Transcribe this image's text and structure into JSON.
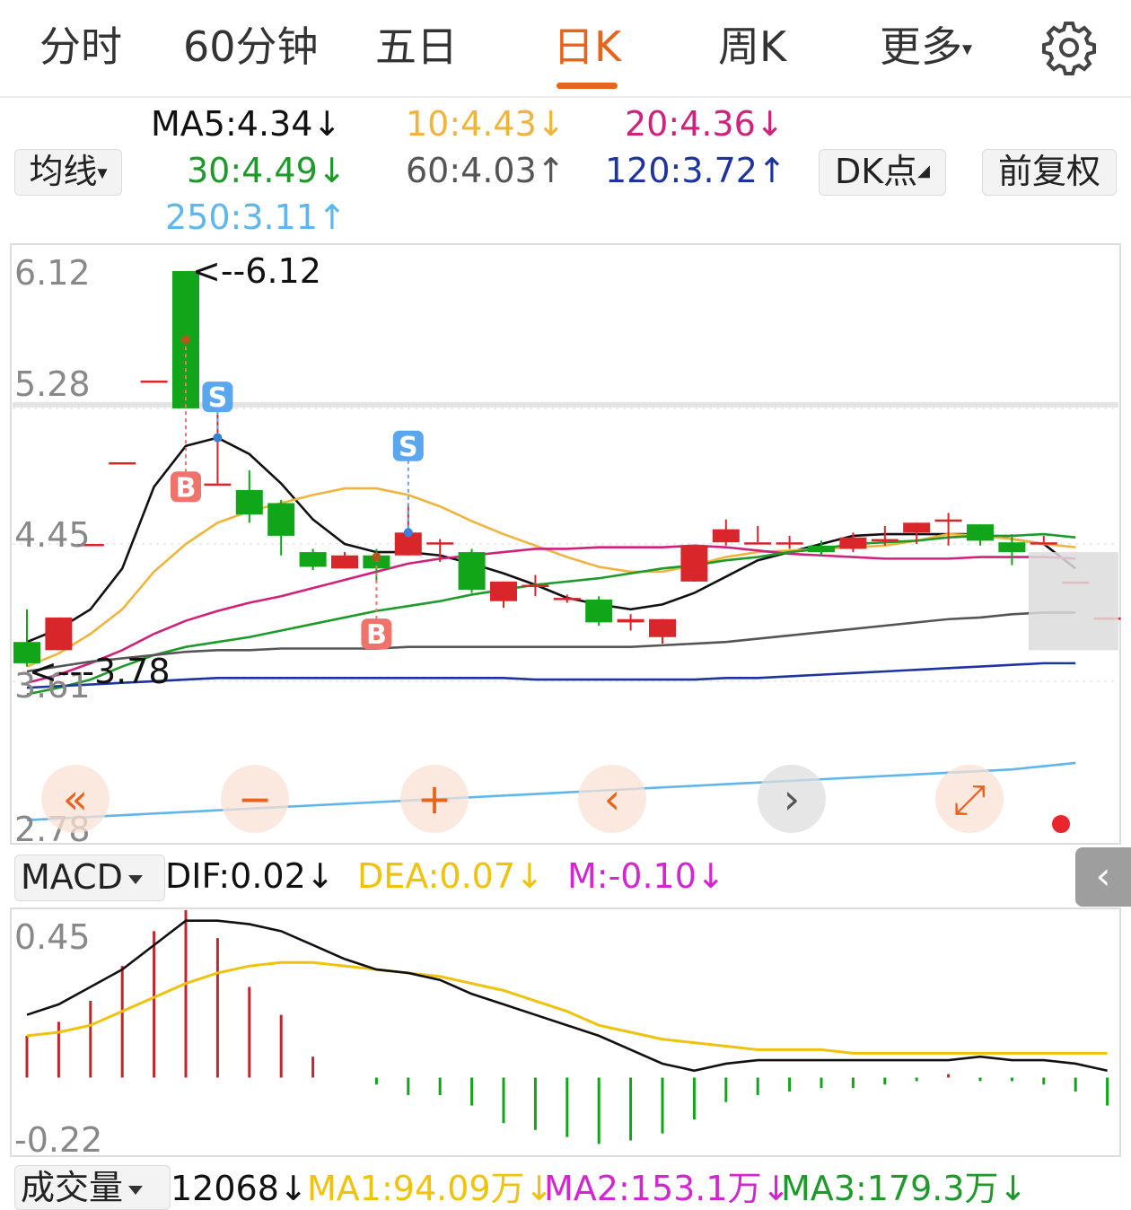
{
  "tabs": [
    "分时",
    "60分钟",
    "五日",
    "日K",
    "周K",
    "更多"
  ],
  "active_tab": "日K",
  "settings_icon": "gear-icon",
  "ma_selector": "均线",
  "ma_values": {
    "ma5": "MA5:4.34",
    "ma10": "10:4.43",
    "ma20": "20:4.36",
    "ma30": "30:4.49",
    "ma60": "60:4.03",
    "ma120": "120:3.72",
    "ma250": "250:3.11"
  },
  "ma_trend": {
    "ma5": "↓",
    "ma10": "↓",
    "ma20": "↓",
    "ma30": "↓",
    "ma60": "↑",
    "ma120": "↑",
    "ma250": "↑"
  },
  "colors": {
    "up": "#d9262b",
    "down": "#11a51a",
    "ma5": "#111111",
    "ma10": "#f0b43c",
    "ma20": "#d0217c",
    "ma30": "#1d9a2a",
    "ma60": "#555555",
    "ma120": "#1d34a0",
    "ma250": "#5eb6ec",
    "accent": "#e8641c",
    "dea": "#f0c20c",
    "m": "#d227d0"
  },
  "dk_button": "DK点",
  "adjust_button": "前复权",
  "price_axis": [
    "6.12",
    "5.28",
    "4.45",
    "3.61",
    "2.78"
  ],
  "high_marker": "<--6.12",
  "low_marker": "<---3.78",
  "signal_markers": [
    "S",
    "B",
    "S",
    "B"
  ],
  "chart_controls": [
    "«",
    "−",
    "+",
    "‹",
    "›",
    "⤢"
  ],
  "macd": {
    "selector": "MACD",
    "dif": "DIF:0.02",
    "dif_trend": "↓",
    "dea": "DEA:0.07",
    "dea_trend": "↓",
    "m": "M:-0.10",
    "m_trend": "↓",
    "axis": [
      "0.45",
      "-0.22"
    ]
  },
  "volume": {
    "selector": "成交量",
    "value": "12068",
    "value_trend": "↓",
    "ma1": "MA1:94.09万",
    "ma1_trend": "↓",
    "ma2": "MA2:153.1万",
    "ma2_trend": "↓",
    "ma3": "MA3:179.3万",
    "ma3_trend": "↓"
  },
  "chart_data": {
    "type": "candlestick",
    "candles": [
      {
        "o": 3.85,
        "c": 3.72,
        "h": 4.05,
        "l": 3.7
      },
      {
        "o": 3.8,
        "c": 4.0,
        "h": 4.0,
        "l": 3.8
      },
      {
        "o": 4.45,
        "c": 4.45,
        "h": 4.45,
        "l": 4.45
      },
      {
        "o": 4.95,
        "c": 4.95,
        "h": 4.95,
        "l": 4.95
      },
      {
        "o": 5.45,
        "c": 5.45,
        "h": 5.45,
        "l": 5.45
      },
      {
        "o": 6.12,
        "c": 5.28,
        "h": 6.12,
        "l": 5.28
      },
      {
        "o": 4.82,
        "c": 4.82,
        "h": 5.25,
        "l": 4.82
      },
      {
        "o": 4.78,
        "c": 4.63,
        "h": 4.9,
        "l": 4.58
      },
      {
        "o": 4.7,
        "c": 4.5,
        "h": 4.72,
        "l": 4.38
      },
      {
        "o": 4.4,
        "c": 4.31,
        "h": 4.42,
        "l": 4.29
      },
      {
        "o": 4.3,
        "c": 4.38,
        "h": 4.4,
        "l": 4.3
      },
      {
        "o": 4.38,
        "c": 4.3,
        "h": 4.42,
        "l": 4.22
      },
      {
        "o": 4.38,
        "c": 4.52,
        "h": 4.7,
        "l": 4.38
      },
      {
        "o": 4.46,
        "c": 4.46,
        "h": 4.48,
        "l": 4.34
      },
      {
        "o": 4.4,
        "c": 4.17,
        "h": 4.42,
        "l": 4.15
      },
      {
        "o": 4.1,
        "c": 4.22,
        "h": 4.22,
        "l": 4.06
      },
      {
        "o": 4.2,
        "c": 4.2,
        "h": 4.26,
        "l": 4.13
      },
      {
        "o": 4.12,
        "c": 4.12,
        "h": 4.14,
        "l": 4.09
      },
      {
        "o": 4.11,
        "c": 3.97,
        "h": 4.13,
        "l": 3.95
      },
      {
        "o": 3.97,
        "c": 3.99,
        "h": 4.02,
        "l": 3.92
      },
      {
        "o": 3.88,
        "c": 3.99,
        "h": 3.99,
        "l": 3.84
      },
      {
        "o": 4.22,
        "c": 4.44,
        "h": 4.44,
        "l": 4.22
      },
      {
        "o": 4.46,
        "c": 4.54,
        "h": 4.6,
        "l": 4.44
      },
      {
        "o": 4.46,
        "c": 4.46,
        "h": 4.56,
        "l": 4.46
      },
      {
        "o": 4.46,
        "c": 4.46,
        "h": 4.5,
        "l": 4.42
      },
      {
        "o": 4.44,
        "c": 4.4,
        "h": 4.47,
        "l": 4.38
      },
      {
        "o": 4.42,
        "c": 4.49,
        "h": 4.52,
        "l": 4.4
      },
      {
        "o": 4.48,
        "c": 4.48,
        "h": 4.56,
        "l": 4.44
      },
      {
        "o": 4.52,
        "c": 4.58,
        "h": 4.58,
        "l": 4.45
      },
      {
        "o": 4.6,
        "c": 4.6,
        "h": 4.64,
        "l": 4.44
      },
      {
        "o": 4.57,
        "c": 4.47,
        "h": 4.57,
        "l": 4.44
      },
      {
        "o": 4.46,
        "c": 4.4,
        "h": 4.51,
        "l": 4.32
      },
      {
        "o": 4.46,
        "c": 4.46,
        "h": 4.5,
        "l": 4.46
      },
      {
        "o": 4.22,
        "c": 4.22,
        "h": 4.22,
        "l": 4.22
      },
      {
        "o": 4.0,
        "c": 4.0,
        "h": 4.0,
        "l": 4.0
      }
    ],
    "ma_series": {
      "ma5": [
        3.85,
        3.93,
        4.05,
        4.3,
        4.8,
        5.05,
        5.1,
        5.0,
        4.82,
        4.6,
        4.45,
        4.4,
        4.4,
        4.38,
        4.33,
        4.27,
        4.2,
        4.12,
        4.08,
        4.05,
        4.08,
        4.15,
        4.25,
        4.35,
        4.4,
        4.45,
        4.5,
        4.51,
        4.51,
        4.51,
        4.51,
        4.48,
        4.45,
        4.3
      ],
      "ma10": [
        3.7,
        3.78,
        3.9,
        4.05,
        4.28,
        4.45,
        4.58,
        4.65,
        4.7,
        4.75,
        4.79,
        4.79,
        4.75,
        4.68,
        4.59,
        4.51,
        4.44,
        4.37,
        4.31,
        4.28,
        4.28,
        4.32,
        4.37,
        4.4,
        4.41,
        4.42,
        4.43,
        4.44,
        4.47,
        4.51,
        4.5,
        4.48,
        4.45,
        4.43
      ],
      "ma20": [
        3.6,
        3.65,
        3.72,
        3.8,
        3.9,
        3.98,
        4.04,
        4.09,
        4.13,
        4.18,
        4.23,
        4.28,
        4.33,
        4.36,
        4.38,
        4.4,
        4.42,
        4.42,
        4.43,
        4.43,
        4.43,
        4.44,
        4.43,
        4.41,
        4.39,
        4.38,
        4.37,
        4.36,
        4.36,
        4.36,
        4.37,
        4.37,
        4.37,
        4.36
      ],
      "ma30": [
        3.53,
        3.57,
        3.62,
        3.7,
        3.77,
        3.82,
        3.85,
        3.88,
        3.92,
        3.96,
        4.0,
        4.04,
        4.07,
        4.1,
        4.14,
        4.17,
        4.2,
        4.22,
        4.24,
        4.27,
        4.3,
        4.32,
        4.35,
        4.37,
        4.4,
        4.42,
        4.45,
        4.46,
        4.47,
        4.49,
        4.5,
        4.5,
        4.51,
        4.49
      ],
      "ma60": [
        3.67,
        3.7,
        3.73,
        3.75,
        3.77,
        3.79,
        3.8,
        3.8,
        3.81,
        3.81,
        3.81,
        3.81,
        3.82,
        3.82,
        3.82,
        3.82,
        3.82,
        3.82,
        3.82,
        3.82,
        3.83,
        3.84,
        3.85,
        3.87,
        3.89,
        3.91,
        3.93,
        3.95,
        3.97,
        3.99,
        4.0,
        4.02,
        4.03,
        4.03
      ],
      "ma120": [
        3.57,
        3.58,
        3.59,
        3.6,
        3.61,
        3.62,
        3.63,
        3.63,
        3.63,
        3.63,
        3.63,
        3.63,
        3.63,
        3.63,
        3.63,
        3.63,
        3.62,
        3.62,
        3.62,
        3.62,
        3.62,
        3.62,
        3.63,
        3.63,
        3.64,
        3.65,
        3.66,
        3.67,
        3.68,
        3.69,
        3.7,
        3.71,
        3.72,
        3.72
      ],
      "ma250": [
        2.76,
        2.77,
        2.78,
        2.79,
        2.8,
        2.81,
        2.82,
        2.83,
        2.84,
        2.85,
        2.86,
        2.87,
        2.88,
        2.89,
        2.9,
        2.91,
        2.92,
        2.93,
        2.94,
        2.95,
        2.96,
        2.97,
        2.98,
        2.99,
        3.0,
        3.01,
        3.02,
        3.03,
        3.04,
        3.05,
        3.06,
        3.07,
        3.09,
        3.11
      ]
    },
    "macd_dif": [
      0.18,
      0.21,
      0.26,
      0.31,
      0.38,
      0.45,
      0.45,
      0.44,
      0.42,
      0.38,
      0.34,
      0.31,
      0.3,
      0.28,
      0.24,
      0.21,
      0.18,
      0.15,
      0.12,
      0.08,
      0.04,
      0.02,
      0.04,
      0.05,
      0.05,
      0.05,
      0.05,
      0.05,
      0.05,
      0.05,
      0.06,
      0.05,
      0.05,
      0.04,
      0.02
    ],
    "macd_dea": [
      0.12,
      0.13,
      0.15,
      0.19,
      0.23,
      0.27,
      0.3,
      0.32,
      0.33,
      0.33,
      0.32,
      0.31,
      0.3,
      0.29,
      0.27,
      0.25,
      0.22,
      0.19,
      0.15,
      0.13,
      0.11,
      0.1,
      0.09,
      0.08,
      0.08,
      0.08,
      0.07,
      0.07,
      0.07,
      0.07,
      0.07,
      0.07,
      0.07,
      0.07,
      0.07
    ],
    "macd_m": [
      0.12,
      0.16,
      0.22,
      0.32,
      0.42,
      0.48,
      0.4,
      0.26,
      0.18,
      0.06,
      0,
      -0.02,
      -0.05,
      -0.05,
      -0.08,
      -0.13,
      -0.15,
      -0.17,
      -0.19,
      -0.18,
      -0.16,
      -0.12,
      -0.07,
      -0.05,
      -0.04,
      -0.03,
      -0.03,
      -0.02,
      -0.01,
      0.01,
      -0.01,
      -0.01,
      -0.02,
      -0.04,
      -0.08
    ]
  }
}
